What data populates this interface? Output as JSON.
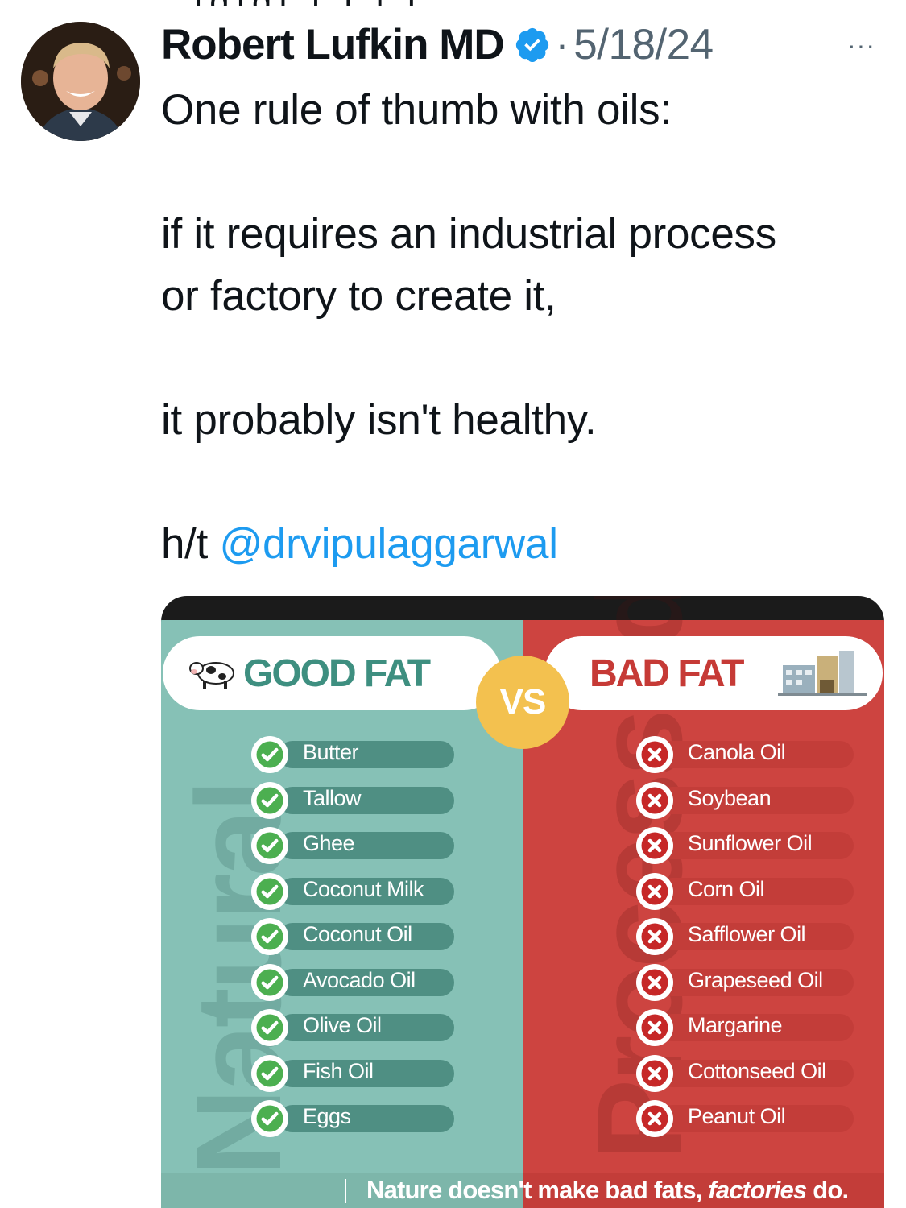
{
  "tweet": {
    "author_name": "Robert Lufkin MD",
    "separator": "·",
    "date": "5/18/24",
    "more_label": "···",
    "lines": [
      "One rule of thumb with oils:",
      "if it requires an industrial process",
      "or factory to create it,",
      "it probably isn't healthy."
    ],
    "ht_prefix": "h/t",
    "mention": "@drvipulaggarwal"
  },
  "infographic": {
    "good_title": "GOOD FAT",
    "vs_label": "VS",
    "bad_title": "BAD FAT",
    "left_vertical_word": "Natural",
    "right_vertical_word": "Processed",
    "good_fats": [
      "Butter",
      "Tallow",
      "Ghee",
      "Coconut Milk",
      "Coconut Oil",
      "Avocado Oil",
      "Olive Oil",
      "Fish Oil",
      "Eggs"
    ],
    "bad_fats": [
      "Canola Oil",
      "Soybean",
      "Sunflower Oil",
      "Corn Oil",
      "Safflower Oil",
      "Grapeseed Oil",
      "Margarine",
      "Cottonseed Oil",
      "Peanut Oil"
    ],
    "footer_plain": "Nature doesn't make bad fats,",
    "footer_emph": "factories",
    "footer_end": "do."
  },
  "colors": {
    "good_bg": "#86c1b6",
    "bad_bg": "#cd4440",
    "check_green": "#4caf50",
    "cross_red": "#c62828",
    "link_blue": "#1d9bf0",
    "verified_blue": "#1d9bf0"
  },
  "icons": {
    "verified": "verified-badge-icon",
    "good_mark": "check-circle-icon",
    "bad_mark": "x-circle-icon",
    "cow": "cow-icon",
    "factory": "factory-icon"
  }
}
